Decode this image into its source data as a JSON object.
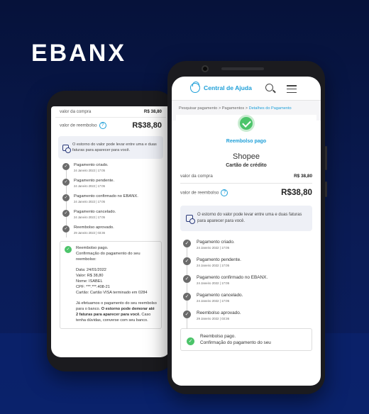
{
  "brand": {
    "logo": "EBANX"
  },
  "left_screen": {
    "purchase_label": "valor da compra",
    "purchase_value": "R$ 38,80",
    "refund_label": "valor de reembolso",
    "refund_value": "R$38,80",
    "notice": "O estorno do valor pode levar entre uma e duas faturas para aparecer para você.",
    "timeline": [
      {
        "title": "Pagamento criado.",
        "date": "24 Janeiro 2022 | 17:05"
      },
      {
        "title": "Pagamento pendente.",
        "date": "24 Janeiro 2022 | 17:05"
      },
      {
        "title": "Pagamento confirmado no EBANX.",
        "date": "24 Janeiro 2022 | 17:05"
      },
      {
        "title": "Pagamento cancelado.",
        "date": "24 Janeiro 2022 | 17:05"
      },
      {
        "title": "Reembolso aprovado.",
        "date": "29 Janeiro 2022 | 03:36"
      }
    ],
    "paid": {
      "title": "Reembolso pago.",
      "subtitle": "Confirmação do pagamento do seu reembolso:",
      "date_line": "Data: 24/01/2022",
      "value_line": "Valor: R$ 38,80",
      "name_line": "Nome: ISABEL",
      "cpf_line": "CPF: ***.***.408-21",
      "card_line": "Cartão: Cartão VISA terminado em 0284",
      "msg_a": "Já efetuamos o pagamento do seu reembolso para o banco.",
      "msg_bold": "O estorno pode demorar até 2 faturas para aparecer para você.",
      "msg_b": "Caso tenha dúvidas, converse com seu banco."
    }
  },
  "right_screen": {
    "header": {
      "title": "Central de Ajuda"
    },
    "breadcrumb": {
      "item1": "Pesquisar pagamento",
      "sep": " > ",
      "item2": "Pagamentos",
      "current": "Detalhes do Pagamento"
    },
    "status": "Reembolso pago",
    "merchant": "Shopee",
    "payment_type": "Cartão de crédito",
    "purchase_label": "valor da compra",
    "purchase_value": "R$ 38,80",
    "refund_label": "valor de reembolso",
    "refund_value": "R$38,80",
    "notice": "O estorno do valor pode levar entre uma e duas faturas para aparecer para você.",
    "timeline": [
      {
        "title": "Pagamento criado.",
        "date": "24 Janeiro 2022 | 17:05"
      },
      {
        "title": "Pagamento pendente.",
        "date": "24 Janeiro 2022 | 17:05"
      },
      {
        "title": "Pagamento confirmado no EBANX.",
        "date": "24 Janeiro 2022 | 17:05"
      },
      {
        "title": "Pagamento cancelado.",
        "date": "24 Janeiro 2022 | 17:05"
      },
      {
        "title": "Reembolso aprovado.",
        "date": "29 Janeiro 2022 | 03:36"
      }
    ],
    "paid": {
      "title": "Reembolso pago.",
      "subtitle": "Confirmação do pagamento do seu"
    }
  },
  "icons": {
    "check": "✓"
  }
}
